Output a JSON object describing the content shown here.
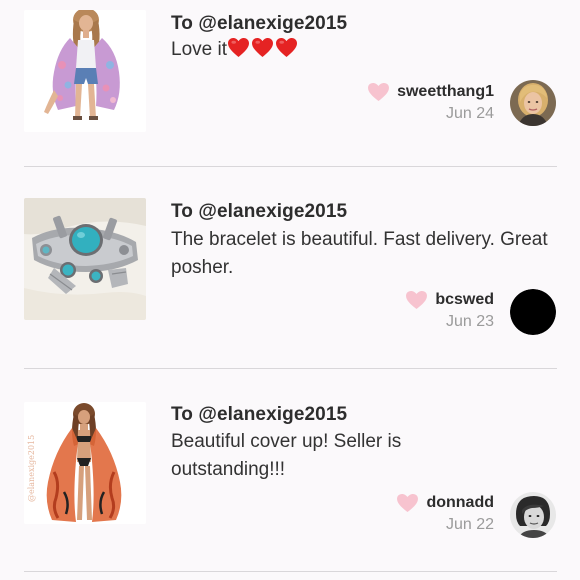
{
  "reviews": [
    {
      "recipient": "To @elanexige2015",
      "comment": "Love it",
      "comment_emoji": [
        "red-heart",
        "red-heart",
        "red-heart"
      ],
      "username": "sweetthang1",
      "date": "Jun 24",
      "thumbnail": "floral-kimono-photo",
      "avatar": "blonde-woman-avatar"
    },
    {
      "recipient": "To @elanexige2015",
      "comment": "The bracelet is beautiful. Fast delivery. Great posher.",
      "comment_emoji": [],
      "username": "bcswed",
      "date": "Jun 23",
      "thumbnail": "turquoise-bracelet-photo",
      "avatar": "black-circle-avatar"
    },
    {
      "recipient": "To @elanexige2015",
      "comment": "Beautiful cover up! Seller is outstanding!!!",
      "comment_emoji": [],
      "username": "donnadd",
      "date": "Jun 22",
      "thumbnail": "orange-coverup-photo",
      "thumbnail_watermark": "@elanexige2015",
      "avatar": "woman-bw-avatar"
    }
  ],
  "colors": {
    "background": "#fbf9fb",
    "divider": "#d9d7da",
    "like_heart": "#f7c3cf",
    "emoji_heart": "#e52323",
    "text": "#333333",
    "muted": "#9b9b9b"
  }
}
